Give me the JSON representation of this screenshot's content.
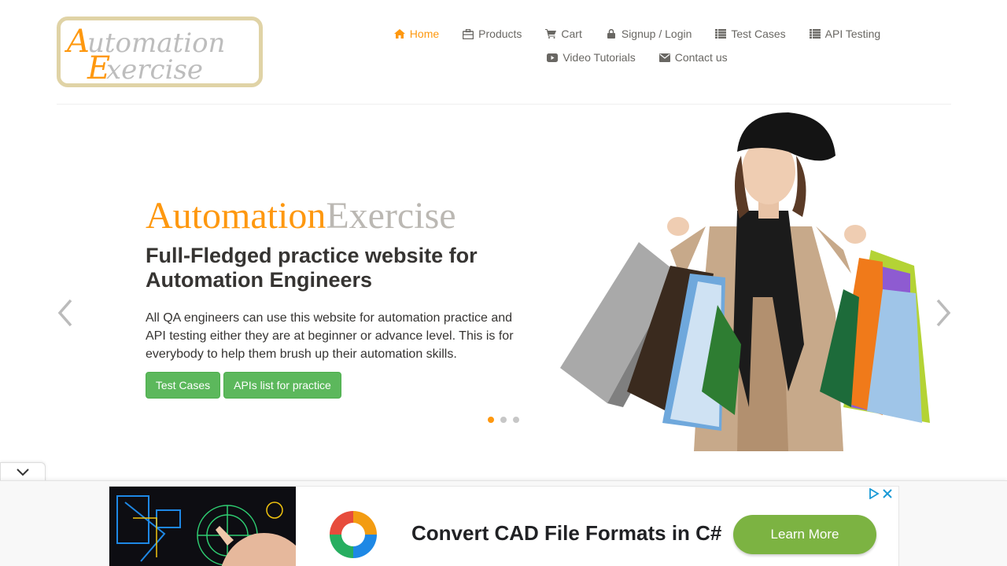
{
  "logo": {
    "line1": "Automation",
    "line2": "Exercise"
  },
  "nav": {
    "items": [
      {
        "label": "Home",
        "icon": "home-icon",
        "active": true
      },
      {
        "label": "Products",
        "icon": "briefcase-icon"
      },
      {
        "label": "Cart",
        "icon": "cart-icon"
      },
      {
        "label": "Signup / Login",
        "icon": "lock-icon"
      },
      {
        "label": "Test Cases",
        "icon": "list-icon"
      },
      {
        "label": "API Testing",
        "icon": "list-icon"
      },
      {
        "label": "Video Tutorials",
        "icon": "youtube-play-icon"
      },
      {
        "label": "Contact us",
        "icon": "envelope-icon"
      }
    ]
  },
  "slider": {
    "brand_a": "Automation",
    "brand_b": "Exercise",
    "heading": "Full-Fledged practice website for Automation Engineers",
    "description": "All QA engineers can use this website for automation practice and API testing either they are at beginner or advance level. This is for everybody to help them brush up their automation skills.",
    "btn_test_cases": "Test Cases",
    "btn_apis": "APIs list for practice",
    "active_slide": 1,
    "slide_count": 3
  },
  "ad": {
    "title": "Convert CAD File Formats in C#",
    "cta": "Learn More"
  },
  "colors": {
    "accent": "#FE980F",
    "button_green": "#5cb85c",
    "ad_cta": "#7cb342"
  }
}
